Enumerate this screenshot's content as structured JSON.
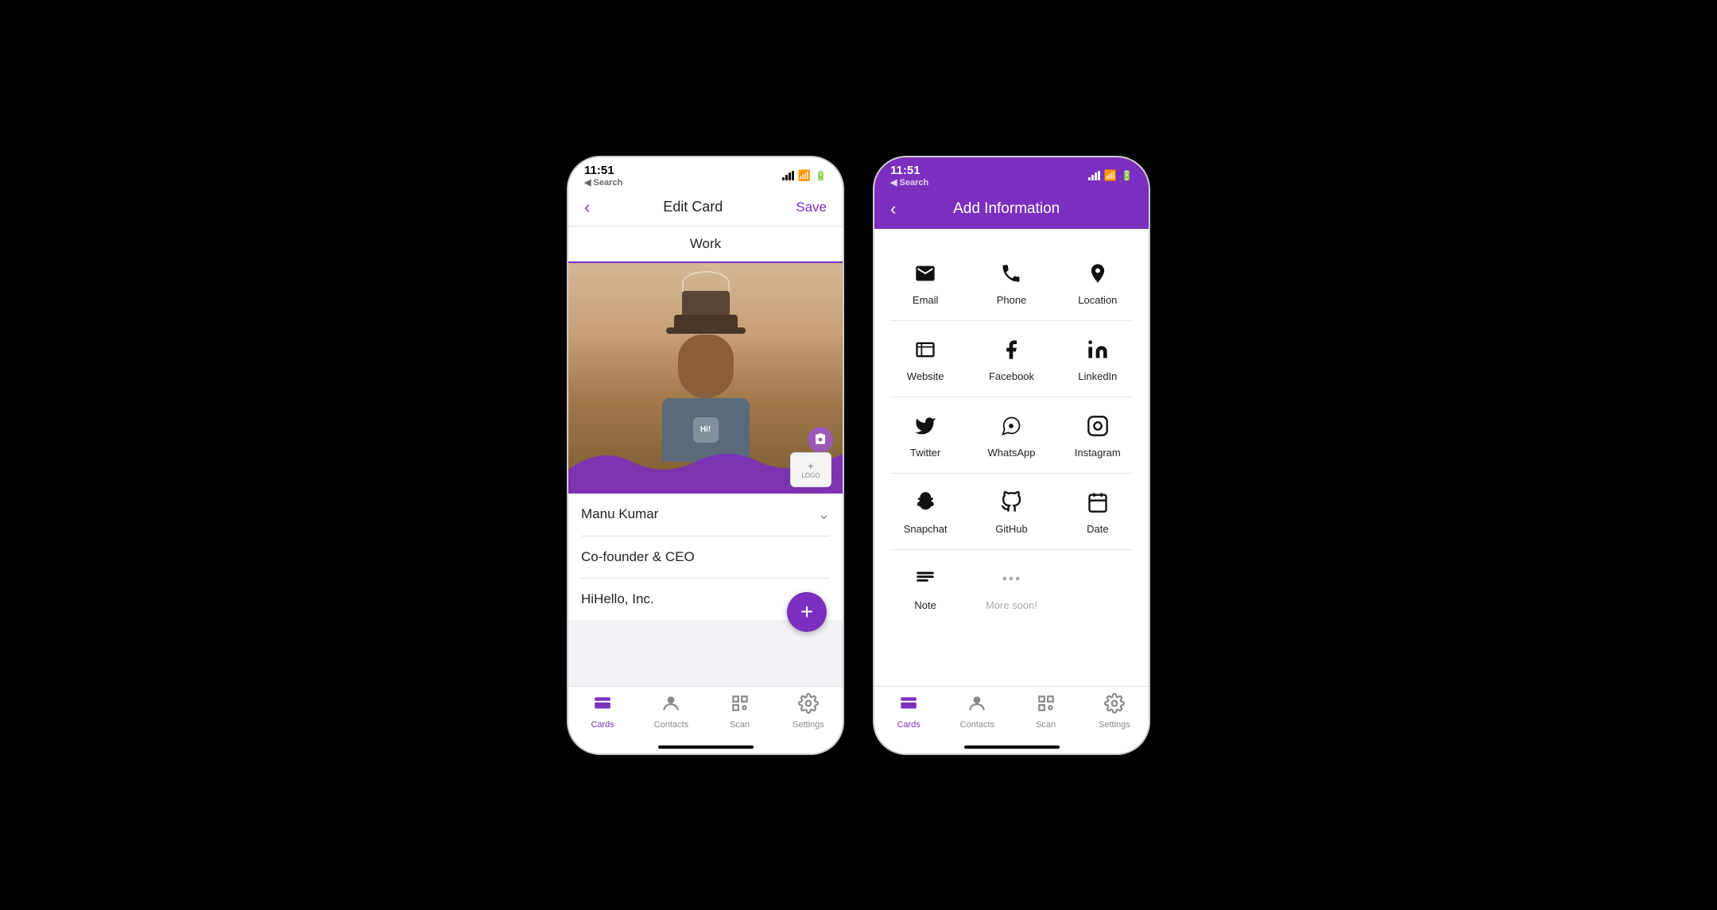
{
  "screens": {
    "editCard": {
      "statusBar": {
        "time": "11:51",
        "timeArrow": "▲",
        "searchBack": "◀ Search"
      },
      "header": {
        "backIcon": "‹",
        "title": "Edit Card",
        "saveLabel": "Save"
      },
      "workTab": "Work",
      "profileCard": {
        "cameraIcon": "📷",
        "logoPlus": "+",
        "logoLabel": "LOGO",
        "nameField": "Manu Kumar",
        "titleField": "Co-founder & CEO",
        "companyField": "HiHello, Inc.",
        "fabIcon": "+"
      },
      "tabBar": {
        "items": [
          {
            "label": "Cards",
            "icon": "cards",
            "active": true
          },
          {
            "label": "Contacts",
            "icon": "contacts",
            "active": false
          },
          {
            "label": "Scan",
            "icon": "scan",
            "active": false
          },
          {
            "label": "Settings",
            "icon": "settings",
            "active": false
          }
        ]
      }
    },
    "addInfo": {
      "statusBar": {
        "time": "11:51",
        "timeArrow": "▲",
        "searchBack": "◀ Search"
      },
      "header": {
        "backIcon": "‹",
        "title": "Add Information"
      },
      "infoItems": [
        {
          "label": "Email",
          "icon": "email"
        },
        {
          "label": "Phone",
          "icon": "phone"
        },
        {
          "label": "Location",
          "icon": "location"
        },
        {
          "label": "Website",
          "icon": "website"
        },
        {
          "label": "Facebook",
          "icon": "facebook"
        },
        {
          "label": "LinkedIn",
          "icon": "linkedin"
        },
        {
          "label": "Twitter",
          "icon": "twitter"
        },
        {
          "label": "WhatsApp",
          "icon": "whatsapp"
        },
        {
          "label": "Instagram",
          "icon": "instagram"
        },
        {
          "label": "Snapchat",
          "icon": "snapchat"
        },
        {
          "label": "GitHub",
          "icon": "github"
        },
        {
          "label": "Date",
          "icon": "date"
        },
        {
          "label": "Note",
          "icon": "note"
        },
        {
          "label": "More soon!",
          "icon": "more",
          "disabled": true
        }
      ],
      "tabBar": {
        "items": [
          {
            "label": "Cards",
            "icon": "cards",
            "active": true
          },
          {
            "label": "Contacts",
            "icon": "contacts",
            "active": false
          },
          {
            "label": "Scan",
            "icon": "scan",
            "active": false
          },
          {
            "label": "Settings",
            "icon": "settings",
            "active": false
          }
        ]
      }
    }
  },
  "colors": {
    "purple": "#7b2fbe",
    "activeTab": "#7b2fbe"
  }
}
